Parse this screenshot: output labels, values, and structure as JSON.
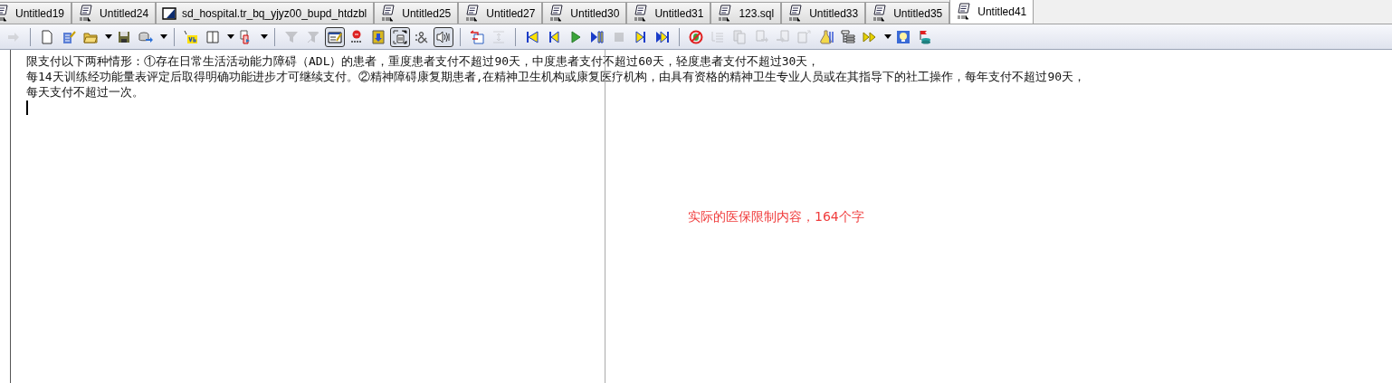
{
  "tabs": [
    {
      "label": "Untitled19",
      "kind": "sql",
      "selected": false
    },
    {
      "label": "Untitled24",
      "kind": "sql",
      "selected": false
    },
    {
      "label": "sd_hospital.tr_bq_yjyz00_bupd_htdzbl",
      "kind": "object",
      "selected": false
    },
    {
      "label": "Untitled25",
      "kind": "sql",
      "selected": false
    },
    {
      "label": "Untitled27",
      "kind": "sql",
      "selected": false
    },
    {
      "label": "Untitled30",
      "kind": "sql",
      "selected": false
    },
    {
      "label": "Untitled31",
      "kind": "sql",
      "selected": false
    },
    {
      "label": "123.sql",
      "kind": "sql",
      "selected": false
    },
    {
      "label": "Untitled33",
      "kind": "sql",
      "selected": false
    },
    {
      "label": "Untitled35",
      "kind": "sql",
      "selected": false
    },
    {
      "label": "Untitled41",
      "kind": "sql",
      "selected": true
    }
  ],
  "toolbar": [
    {
      "kind": "button",
      "disabled": true,
      "pressed": false
    },
    {
      "kind": "separator"
    },
    {
      "kind": "button",
      "disabled": false,
      "pressed": false
    },
    {
      "kind": "button",
      "disabled": false,
      "pressed": false
    },
    {
      "kind": "dropdown",
      "disabled": false,
      "pressed": false
    },
    {
      "kind": "button",
      "disabled": false,
      "pressed": false
    },
    {
      "kind": "dropdown",
      "disabled": false,
      "pressed": false
    },
    {
      "kind": "separator"
    },
    {
      "kind": "button",
      "disabled": false,
      "pressed": false
    },
    {
      "kind": "dropdown",
      "disabled": false,
      "pressed": false
    },
    {
      "kind": "dropdown",
      "disabled": false,
      "pressed": false
    },
    {
      "kind": "separator"
    },
    {
      "kind": "button",
      "disabled": true,
      "pressed": false
    },
    {
      "kind": "button",
      "disabled": true,
      "pressed": false
    },
    {
      "kind": "button",
      "disabled": false,
      "pressed": true
    },
    {
      "kind": "button",
      "disabled": false,
      "pressed": false
    },
    {
      "kind": "button",
      "disabled": false,
      "pressed": false
    },
    {
      "kind": "button",
      "disabled": false,
      "pressed": true
    },
    {
      "kind": "button",
      "disabled": false,
      "pressed": false
    },
    {
      "kind": "button",
      "disabled": false,
      "pressed": true
    },
    {
      "kind": "separator"
    },
    {
      "kind": "button",
      "disabled": false,
      "pressed": false
    },
    {
      "kind": "button",
      "disabled": true,
      "pressed": false
    },
    {
      "kind": "separator"
    },
    {
      "kind": "button",
      "disabled": false,
      "pressed": false
    },
    {
      "kind": "button",
      "disabled": false,
      "pressed": false
    },
    {
      "kind": "button",
      "disabled": false,
      "pressed": false
    },
    {
      "kind": "button",
      "disabled": false,
      "pressed": false
    },
    {
      "kind": "button",
      "disabled": true,
      "pressed": false
    },
    {
      "kind": "button",
      "disabled": false,
      "pressed": false
    },
    {
      "kind": "button",
      "disabled": false,
      "pressed": false
    },
    {
      "kind": "separator"
    },
    {
      "kind": "button",
      "disabled": false,
      "pressed": false
    },
    {
      "kind": "button",
      "disabled": true,
      "pressed": false
    },
    {
      "kind": "button",
      "disabled": true,
      "pressed": false
    },
    {
      "kind": "button",
      "disabled": true,
      "pressed": false
    },
    {
      "kind": "button",
      "disabled": true,
      "pressed": false
    },
    {
      "kind": "button",
      "disabled": true,
      "pressed": false
    },
    {
      "kind": "button",
      "disabled": false,
      "pressed": false
    },
    {
      "kind": "button",
      "disabled": false,
      "pressed": false
    },
    {
      "kind": "dropdown",
      "disabled": false,
      "pressed": false
    },
    {
      "kind": "button",
      "disabled": false,
      "pressed": false
    },
    {
      "kind": "button",
      "disabled": false,
      "pressed": false
    }
  ],
  "editor": {
    "lines": [
      "限支付以下两种情形：①存在日常生活活动能力障碍（ADL）的患者，重度患者支付不超过90天，中度患者支付不超过60天，轻度患者支付不超过30天，",
      "每14天训练经功能量表评定后取得明确功能进步才可继续支付。②精神障碍康复期患者,在精神卫生机构或康复医疗机构，由具有资格的精神卫生专业人员或在其指导下的社工操作，每年支付不超过90天，",
      "每天支付不超过一次。"
    ],
    "annotation": "实际的医保限制内容，164个字"
  }
}
